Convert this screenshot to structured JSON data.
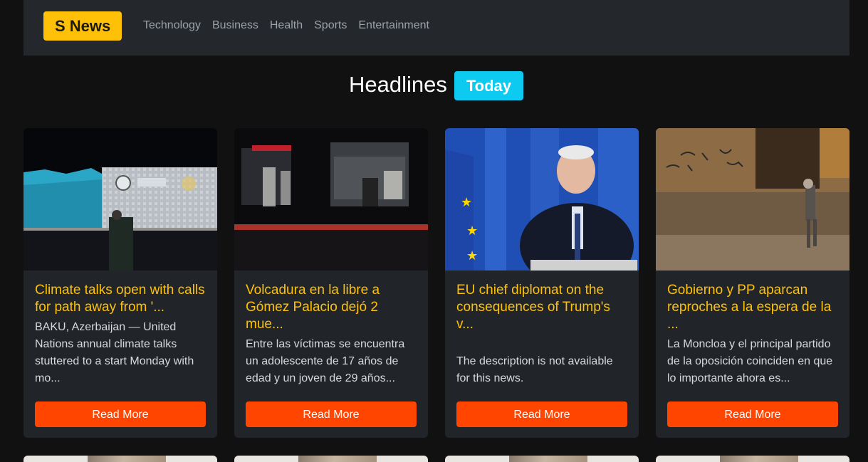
{
  "navbar": {
    "brand": "S News",
    "links": [
      "Technology",
      "Business",
      "Health",
      "Sports",
      "Entertainment"
    ]
  },
  "headline": {
    "title": "Headlines",
    "badge": "Today"
  },
  "cards": [
    {
      "title": "Climate talks open with calls for path away from '...",
      "description": "BAKU, Azerbaijan — United Nations annual climate talks stuttered to a start Monday with mo...",
      "button": "Read More"
    },
    {
      "title": "Volcadura en la libre a Gómez Palacio dejó 2 mue...",
      "description": "Entre las víctimas se encuentra un adolescente de 17 años de edad y un joven de 29 años...",
      "button": "Read More"
    },
    {
      "title": "EU chief diplomat on the consequences of Trump's v...",
      "description": "The description is not available for this news.",
      "button": "Read More"
    },
    {
      "title": "Gobierno y PP aparcan reproches a la espera de la ...",
      "description": "La Moncloa y el principal partido de la oposición coinciden en que lo importante ahora es...",
      "button": "Read More"
    }
  ],
  "colors": {
    "background": "#111111",
    "navbar": "#24282c",
    "brand": "#ffc107",
    "badge": "#0dcaf0",
    "card": "#212529",
    "title": "#ffc107",
    "button": "#ff4500"
  }
}
